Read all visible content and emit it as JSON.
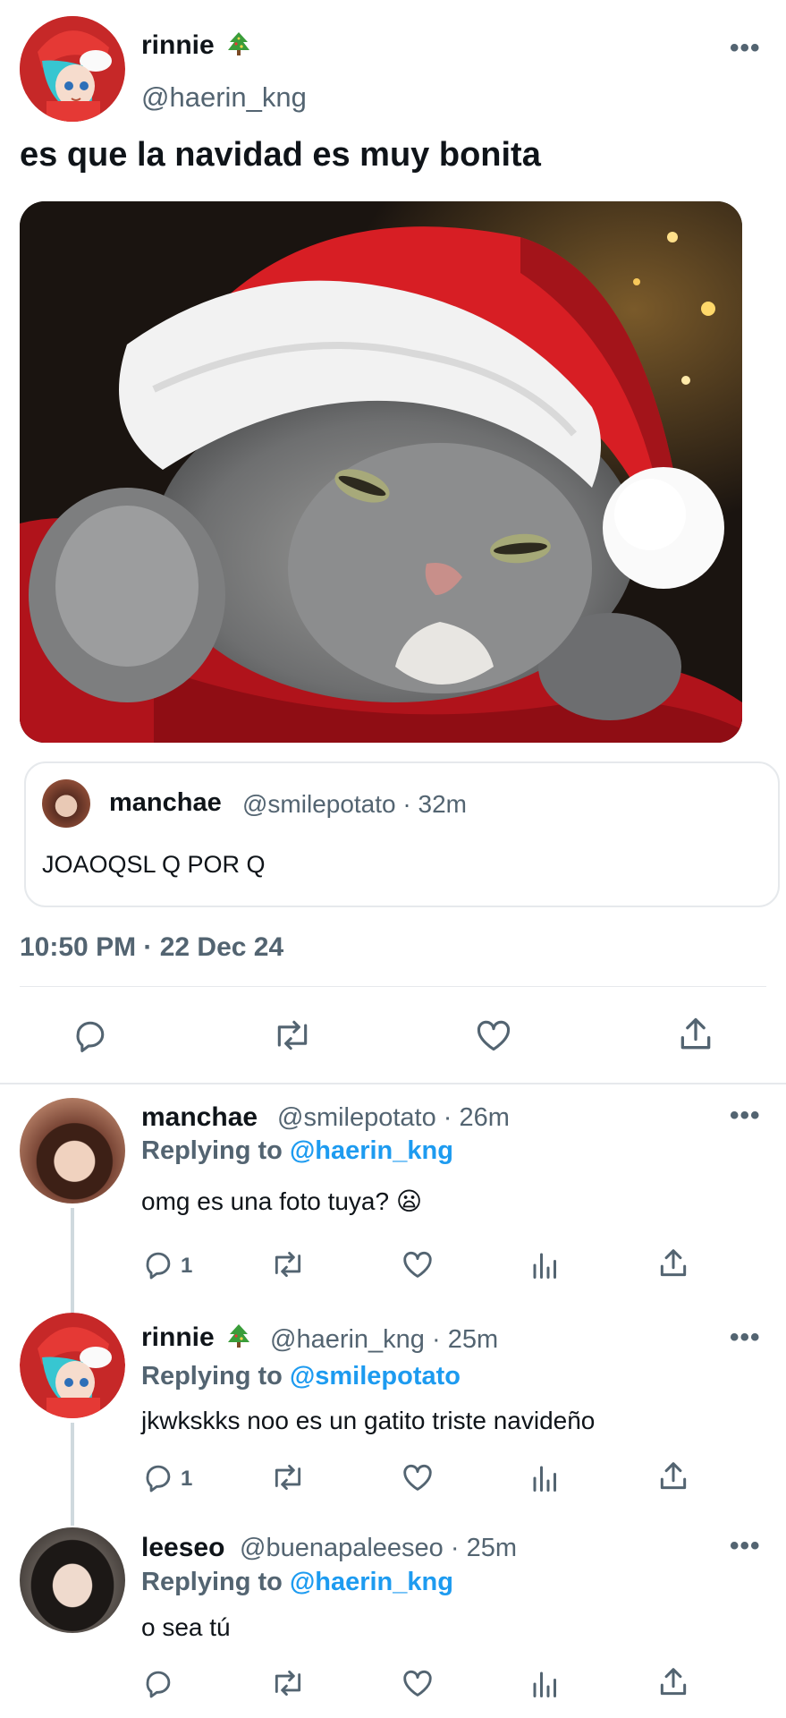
{
  "main_tweet": {
    "display_name": "rinnie",
    "handle": "@haerin_kng",
    "text": "es que la navidad es muy bonita",
    "timestamp": "10:50 PM · 22 Dec 24",
    "quoted": {
      "display_name": "manchae",
      "handle_time": "@smilepotato · 32m",
      "text": "JOAOQSL Q POR Q"
    }
  },
  "replies": [
    {
      "display_name": "manchae",
      "handle_time": "@smilepotato · 26m",
      "replying_prefix": "Replying to ",
      "replying_to": "@haerin_kng",
      "text": "omg es una foto tuya? 😦",
      "reply_count": "1"
    },
    {
      "display_name": "rinnie",
      "handle_time": "@haerin_kng · 25m",
      "replying_prefix": "Replying to ",
      "replying_to": "@smilepotato",
      "text": "jkwkskks noo es un gatito triste navideño",
      "reply_count": "1"
    },
    {
      "display_name": "leeseo",
      "handle_time": "@buenapaleeseo · 25m",
      "replying_prefix": "Replying to ",
      "replying_to": "@haerin_kng",
      "text": "o sea tú",
      "reply_count": ""
    }
  ],
  "colors": {
    "link": "#1d9bf0",
    "muted": "#536471",
    "text": "#0f1419"
  },
  "icons": [
    "more-icon",
    "christmas-tree-emoji",
    "reply-icon",
    "retweet-icon",
    "like-icon",
    "share-icon",
    "views-icon"
  ]
}
